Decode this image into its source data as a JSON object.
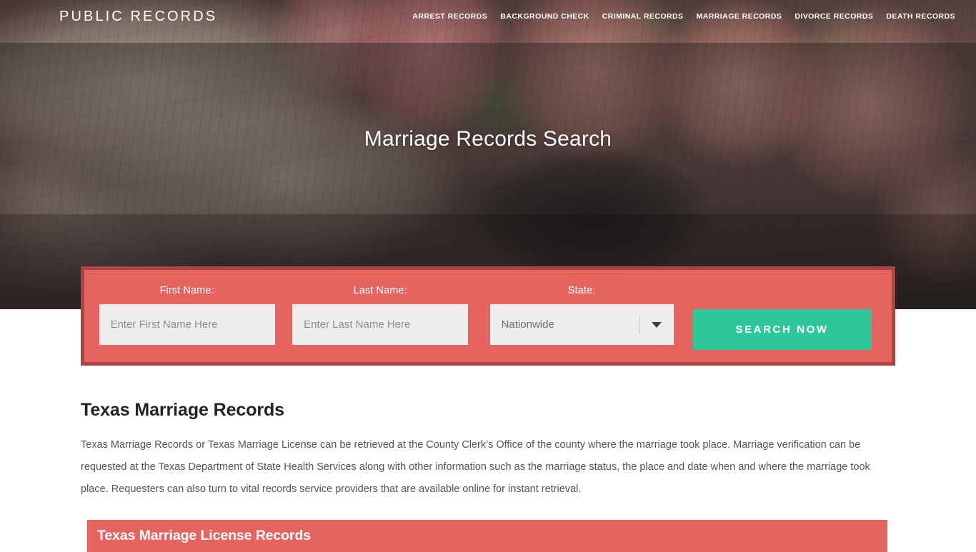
{
  "header": {
    "logo": "PUBLIC RECORDS",
    "nav": [
      {
        "label": "ARREST RECORDS",
        "active": false
      },
      {
        "label": "BACKGROUND CHECK",
        "active": false
      },
      {
        "label": "CRIMINAL RECORDS",
        "active": false
      },
      {
        "label": "MARRIAGE RECORDS",
        "active": true
      },
      {
        "label": "DIVORCE RECORDS",
        "active": false
      },
      {
        "label": "DEATH RECORDS",
        "active": false
      }
    ]
  },
  "hero": {
    "title": "Marriage Records Search"
  },
  "search_form": {
    "first_name": {
      "label": "First Name:",
      "placeholder": "Enter First Name Here",
      "value": ""
    },
    "last_name": {
      "label": "Last Name:",
      "placeholder": "Enter Last Name Here",
      "value": ""
    },
    "state": {
      "label": "State:",
      "selected": "Nationwide"
    },
    "submit_label": "SEARCH NOW"
  },
  "main": {
    "heading": "Texas Marriage Records",
    "paragraph": "Texas Marriage Records or Texas Marriage License can be retrieved at the County Clerk’s Office of the county where the marriage took place. Marriage verification can be requested at the Texas Department of State Health Services along with other information such as the marriage status, the place and date when and where the marriage took place. Requesters can also turn to vital records service providers that are available online for instant retrieval.",
    "section_banner_title": "Texas Marriage License Records"
  },
  "colors": {
    "form_red": "#e5645f",
    "form_border": "#7a2c2a",
    "button_green": "#2ec79a",
    "input_gray": "#ededed",
    "heading_dark": "#232323",
    "body_text": "#545454",
    "nav_text": "#ffffff"
  }
}
